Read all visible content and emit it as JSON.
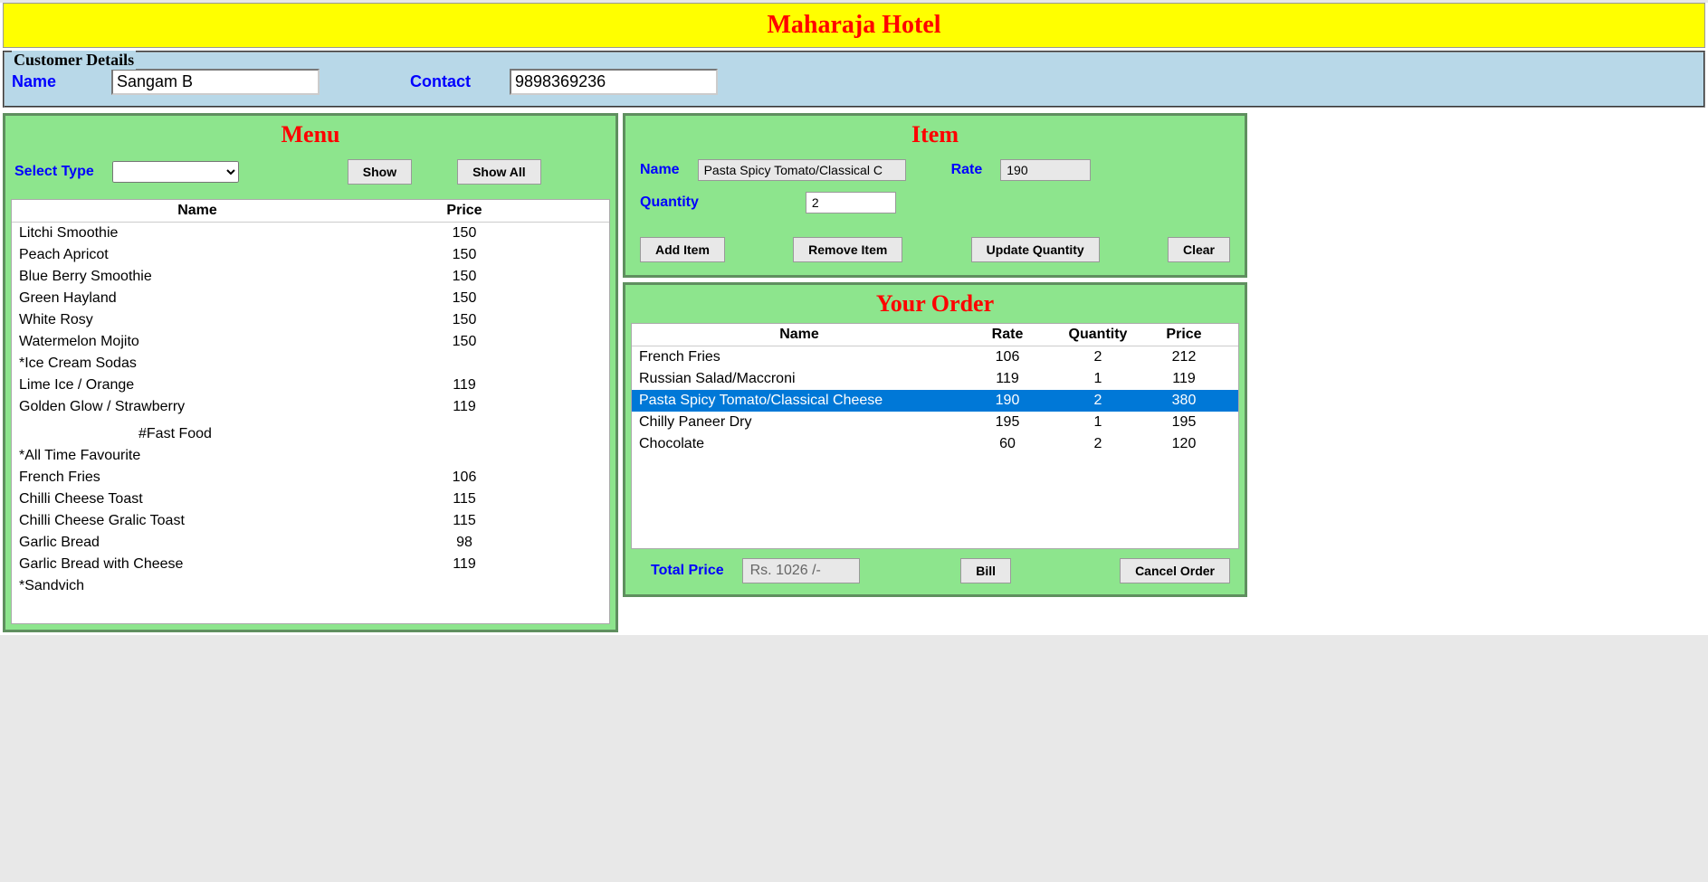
{
  "header": {
    "title": "Maharaja Hotel"
  },
  "customer": {
    "legend": "Customer Details",
    "name_label": "Name",
    "name_value": "Sangam B",
    "contact_label": "Contact",
    "contact_value": "9898369236"
  },
  "menu": {
    "title": "Menu",
    "select_type_label": "Select Type",
    "select_type_value": "",
    "show_label": "Show",
    "show_all_label": "Show All",
    "columns": {
      "name": "Name",
      "price": "Price"
    },
    "items": [
      {
        "name": "Litchi Smoothie",
        "price": "150"
      },
      {
        "name": "Peach Apricot",
        "price": "150"
      },
      {
        "name": "Blue Berry Smoothie",
        "price": "150"
      },
      {
        "name": "Green Hayland",
        "price": "150"
      },
      {
        "name": "White Rosy",
        "price": "150"
      },
      {
        "name": "Watermelon Mojito",
        "price": "150"
      },
      {
        "name": "*Ice Cream Sodas",
        "price": ""
      },
      {
        "name": "Lime Ice / Orange",
        "price": "119"
      },
      {
        "name": "Golden Glow / Strawberry",
        "price": "119"
      },
      {
        "name": "",
        "price": ""
      },
      {
        "name": "#Fast Food",
        "price": "",
        "category": true
      },
      {
        "name": "*All Time Favourite",
        "price": ""
      },
      {
        "name": "French Fries",
        "price": "106"
      },
      {
        "name": "Chilli Cheese Toast",
        "price": "115"
      },
      {
        "name": "Chilli Cheese Gralic Toast",
        "price": "115"
      },
      {
        "name": "Garlic Bread",
        "price": "98"
      },
      {
        "name": "Garlic Bread with Cheese",
        "price": "119"
      },
      {
        "name": "*Sandvich",
        "price": ""
      }
    ]
  },
  "item": {
    "title": "Item",
    "name_label": "Name",
    "name_value": "Pasta Spicy Tomato/Classical C",
    "rate_label": "Rate",
    "rate_value": "190",
    "quantity_label": "Quantity",
    "quantity_value": "2",
    "add_label": "Add Item",
    "remove_label": "Remove Item",
    "update_label": "Update Quantity",
    "clear_label": "Clear"
  },
  "order": {
    "title": "Your Order",
    "columns": {
      "name": "Name",
      "rate": "Rate",
      "quantity": "Quantity",
      "price": "Price"
    },
    "rows": [
      {
        "name": "French Fries",
        "rate": "106",
        "quantity": "2",
        "price": "212",
        "selected": false
      },
      {
        "name": "Russian Salad/Maccroni",
        "rate": "119",
        "quantity": "1",
        "price": "119",
        "selected": false
      },
      {
        "name": "Pasta Spicy Tomato/Classical Cheese",
        "rate": "190",
        "quantity": "2",
        "price": "380",
        "selected": true
      },
      {
        "name": "Chilly Paneer Dry",
        "rate": "195",
        "quantity": "1",
        "price": "195",
        "selected": false
      },
      {
        "name": "Chocolate",
        "rate": "60",
        "quantity": "2",
        "price": "120",
        "selected": false
      }
    ],
    "total_label": "Total Price",
    "total_value": "Rs. 1026  /-",
    "bill_label": "Bill",
    "cancel_label": "Cancel Order"
  }
}
